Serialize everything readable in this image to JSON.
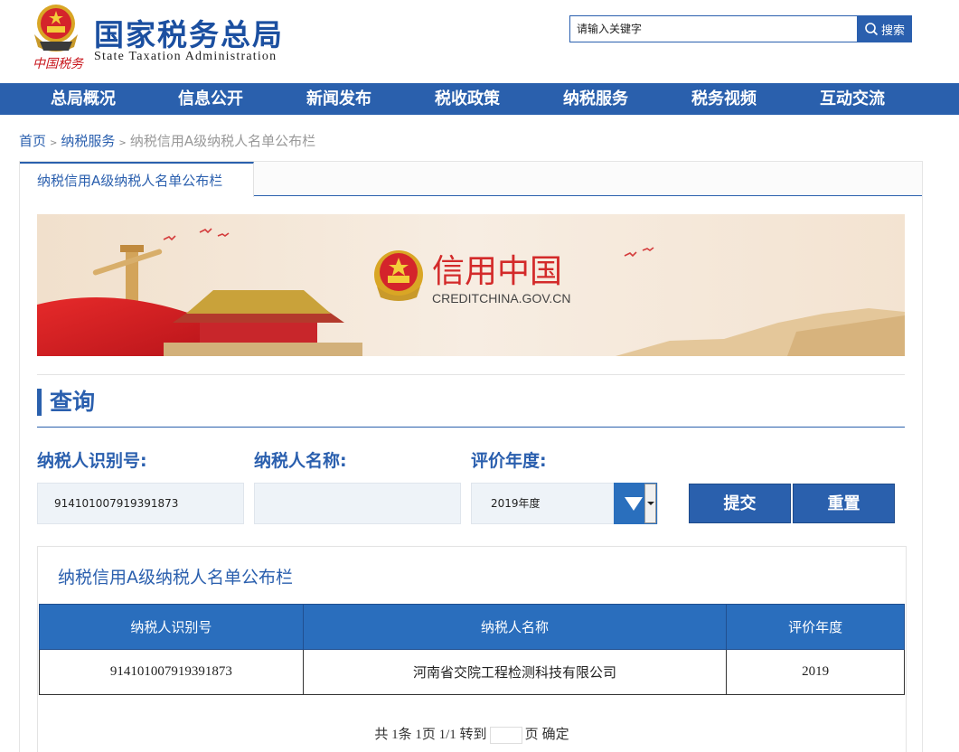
{
  "header": {
    "title": "国家税务总局",
    "subtitle": "State Taxation Administration",
    "seal_text": "中国税务",
    "search_placeholder": "请输入关键字",
    "search_button": "搜索"
  },
  "nav": {
    "items": [
      "总局概况",
      "信息公开",
      "新闻发布",
      "税收政策",
      "纳税服务",
      "税务视频",
      "互动交流"
    ]
  },
  "breadcrumb": {
    "home": "首页",
    "level1": "纳税服务",
    "current": "纳税信用A级纳税人名单公布栏"
  },
  "tab": {
    "label": "纳税信用A级纳税人名单公布栏"
  },
  "banner": {
    "title": "信用中国",
    "url": "CREDITCHINA.GOV.CN"
  },
  "query": {
    "title": "查询",
    "taxid_label": "纳税人识别号:",
    "taxid_value": "914101007919391873",
    "name_label": "纳税人名称:",
    "name_value": "",
    "year_label": "评价年度:",
    "year_value": "2019年度",
    "submit": "提交",
    "reset": "重置"
  },
  "results": {
    "title": "纳税信用A级纳税人名单公布栏",
    "columns": [
      "纳税人识别号",
      "纳税人名称",
      "评价年度"
    ],
    "rows": [
      [
        "914101007919391873",
        "河南省交院工程检测科技有限公司",
        "2019"
      ]
    ],
    "pager": {
      "summary": "共 1条 1页 1/1 转到",
      "page_unit": "页",
      "confirm": "确定"
    }
  },
  "colors": {
    "primary": "#2a60ad",
    "accent_red": "#c8161d"
  }
}
